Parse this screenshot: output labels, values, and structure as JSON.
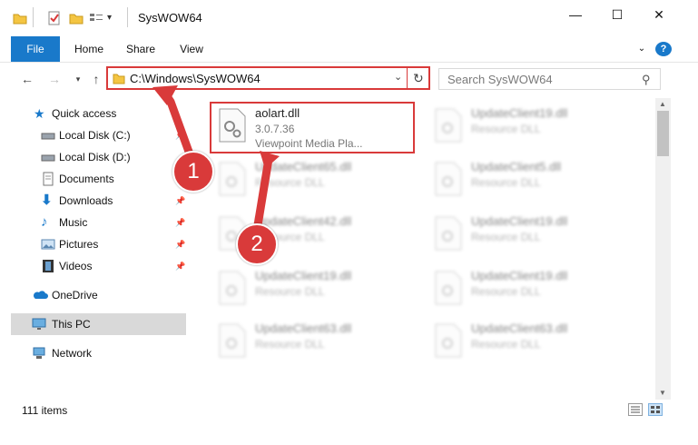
{
  "window": {
    "title": "SysWOW64",
    "minimize_glyph": "—",
    "maximize_glyph": "☐",
    "close_glyph": "✕"
  },
  "ribbon": {
    "tabs": [
      "File",
      "Home",
      "Share",
      "View"
    ],
    "help_glyph": "?"
  },
  "address": {
    "path": "C:\\Windows\\SysWOW64",
    "search_placeholder": "Search SysWOW64"
  },
  "navpane": {
    "items": [
      {
        "label": "Quick access",
        "icon": "star-icon",
        "pinned": false
      },
      {
        "label": "Local Disk (C:)",
        "icon": "drive-icon",
        "pinned": true
      },
      {
        "label": "Local Disk (D:)",
        "icon": "drive-icon",
        "pinned": false
      },
      {
        "label": "Documents",
        "icon": "documents-icon",
        "pinned": true
      },
      {
        "label": "Downloads",
        "icon": "download-icon",
        "pinned": true
      },
      {
        "label": "Music",
        "icon": "music-icon",
        "pinned": true
      },
      {
        "label": "Pictures",
        "icon": "pictures-icon",
        "pinned": true
      },
      {
        "label": "Videos",
        "icon": "videos-icon",
        "pinned": true
      },
      {
        "label": "OneDrive",
        "icon": "cloud-icon",
        "pinned": false
      },
      {
        "label": "This PC",
        "icon": "pc-icon",
        "pinned": false
      },
      {
        "label": "Network",
        "icon": "network-icon",
        "pinned": false
      }
    ]
  },
  "files": {
    "highlighted": {
      "name": "aolart.dll",
      "version": "3.0.7.36",
      "description": "Viewpoint Media Pla..."
    },
    "left_column": [
      {
        "name": "UpdateClient65.dll",
        "type": "Resource DLL"
      },
      {
        "name": "UpdateClient42.dll",
        "type": "Resource DLL"
      },
      {
        "name": "UpdateClient19.dll",
        "type": "Resource DLL"
      },
      {
        "name": "UpdateClient63.dll",
        "type": "Resource DLL"
      }
    ],
    "right_column": [
      {
        "name": "UpdateClient19.dll",
        "type": "Resource DLL"
      },
      {
        "name": "UpdateClient5.dll",
        "type": "Resource DLL"
      },
      {
        "name": "UpdateClient19.dll",
        "type": "Resource DLL"
      },
      {
        "name": "UpdateClient19.dll",
        "type": "Resource DLL"
      },
      {
        "name": "UpdateClient63.dll",
        "type": "Resource DLL"
      }
    ]
  },
  "status": {
    "item_count": "111 items"
  },
  "annotations": {
    "callout_1": "1",
    "callout_2": "2"
  },
  "colors": {
    "accent": "#1979ca",
    "highlight": "#d93a3a"
  }
}
